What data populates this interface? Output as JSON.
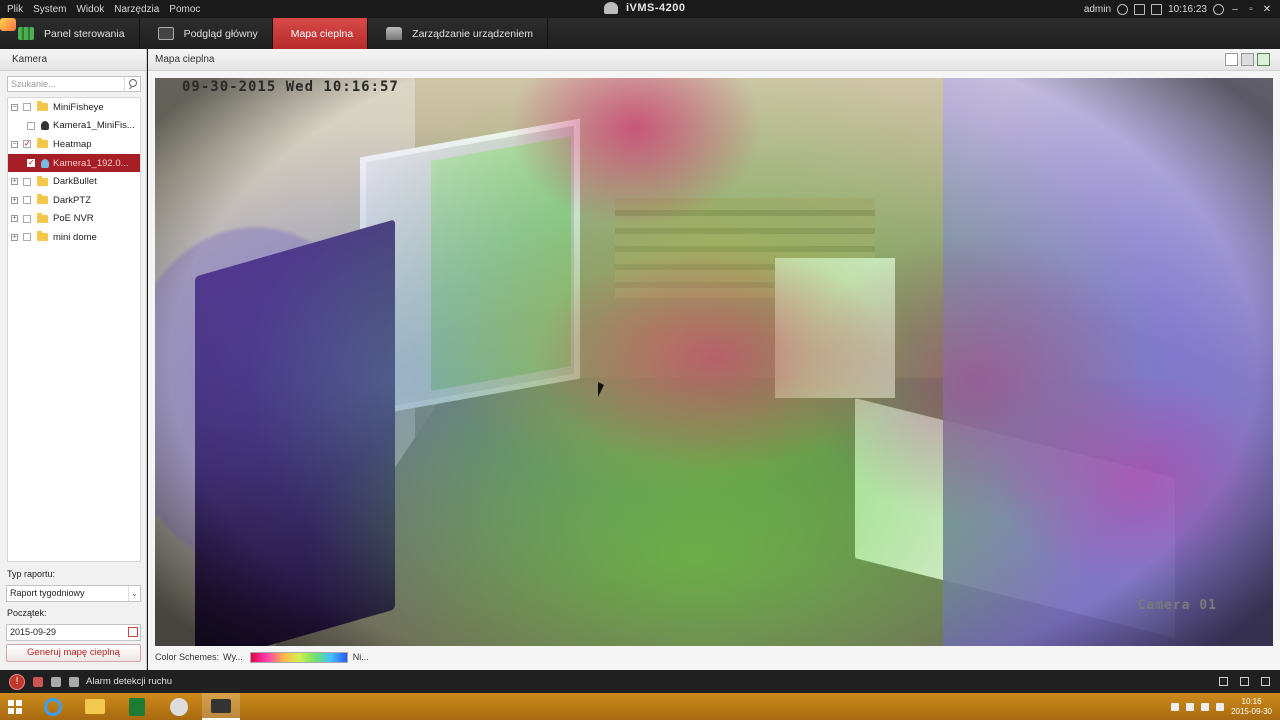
{
  "window": {
    "title": "iVMS-4200",
    "menu": [
      "Plik",
      "System",
      "Widok",
      "Narzędzia",
      "Pomoc"
    ],
    "user": "admin",
    "time": "10:16:23"
  },
  "tabs": [
    {
      "label": "Panel sterowania",
      "icon": "control-panel-icon"
    },
    {
      "label": "Podgląd główny",
      "icon": "main-view-icon"
    },
    {
      "label": "Mapa cieplna",
      "icon": "heatmap-icon",
      "active": true
    },
    {
      "label": "Zarządzanie urządzeniem",
      "icon": "device-management-icon"
    }
  ],
  "left_panel": {
    "header": "Kamera",
    "search_placeholder": "Szukanie...",
    "tree": [
      {
        "label": "MiniFisheye",
        "type": "folder",
        "expanded": true,
        "checked": false
      },
      {
        "label": "Kamera1_MiniFis...",
        "type": "camera",
        "checked": false
      },
      {
        "label": "Heatmap",
        "type": "folder",
        "expanded": true,
        "checked": true
      },
      {
        "label": "Kamera1_192.0...",
        "type": "camera",
        "checked": true,
        "selected": true
      },
      {
        "label": "DarkBullet",
        "type": "folder",
        "expanded": false,
        "checked": false
      },
      {
        "label": "DarkPTZ",
        "type": "folder",
        "expanded": false,
        "checked": false
      },
      {
        "label": "PoE NVR",
        "type": "folder",
        "expanded": false,
        "checked": false
      },
      {
        "label": "mini dome",
        "type": "folder",
        "expanded": false,
        "checked": false
      }
    ],
    "report_type_label": "Typ raportu:",
    "report_type_value": "Raport tygodniowy",
    "start_label": "Początek:",
    "start_value": "2015-09-29",
    "generate_button": "Generuj mapę cieplną"
  },
  "main_panel": {
    "header": "Mapa cieplna",
    "osd_timestamp": "09-30-2015 Wed 10:16:57",
    "osd_camera": "Camera 01",
    "color_schemes_label": "Color Schemes:",
    "color_high": "Wy...",
    "color_low": "Ni..."
  },
  "alarm_bar": {
    "text": "Alarm detekcji ruchu"
  },
  "taskbar": {
    "clock_time": "10:16",
    "clock_date": "2015-09-30"
  },
  "colors": {
    "accent": "#b92b2b",
    "taskbar": "#c0801a"
  }
}
